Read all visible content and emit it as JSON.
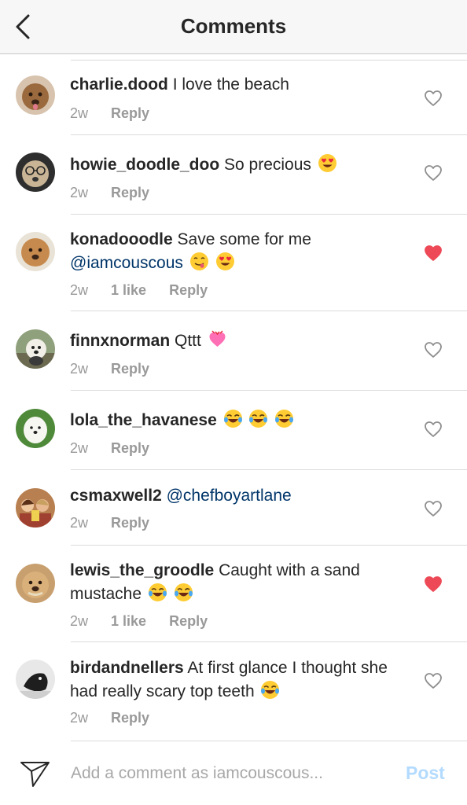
{
  "header": {
    "title": "Comments",
    "back_icon": "chevron-left-icon"
  },
  "comments": [
    {
      "username": "charlie.dood",
      "text": "I love the beach",
      "emojis": [],
      "mention": "",
      "time": "2w",
      "likes": "",
      "reply": "Reply",
      "liked": false
    },
    {
      "username": "howie_doodle_doo",
      "text": "So precious",
      "emojis": [
        "heart-eyes-emoji"
      ],
      "mention": "",
      "time": "2w",
      "likes": "",
      "reply": "Reply",
      "liked": false
    },
    {
      "username": "konadooodle",
      "text": "Save some for me",
      "emojis": [
        "yum-emoji",
        "heart-eyes-emoji"
      ],
      "mention": "@iamcouscous",
      "time": "2w",
      "likes": "1 like",
      "reply": "Reply",
      "liked": true
    },
    {
      "username": "finnxnorman",
      "text": "Qttt",
      "emojis": [
        "heart-ribbon-emoji"
      ],
      "mention": "",
      "time": "2w",
      "likes": "",
      "reply": "Reply",
      "liked": false
    },
    {
      "username": "lola_the_havanese",
      "text": "",
      "emojis": [
        "tears-of-joy-emoji",
        "tears-of-joy-emoji",
        "tears-of-joy-emoji"
      ],
      "mention": "",
      "time": "2w",
      "likes": "",
      "reply": "Reply",
      "liked": false
    },
    {
      "username": "csmaxwell2",
      "text": "",
      "emojis": [],
      "mention": "@chefboyartlane",
      "time": "2w",
      "likes": "",
      "reply": "Reply",
      "liked": false
    },
    {
      "username": "lewis_the_groodle",
      "text": "Caught with a sand mustache",
      "emojis": [
        "tears-of-joy-emoji",
        "tears-of-joy-emoji"
      ],
      "mention": "",
      "time": "2w",
      "likes": "1 like",
      "reply": "Reply",
      "liked": true
    },
    {
      "username": "birdandnellers",
      "text": "At first glance I thought she had really scary top teeth",
      "emojis": [
        "tears-of-joy-emoji"
      ],
      "mention": "",
      "time": "2w",
      "likes": "",
      "reply": "Reply",
      "liked": false
    }
  ],
  "composer": {
    "placeholder": "Add a comment as iamcouscous...",
    "post_label": "Post",
    "send_icon": "paper-plane-icon"
  },
  "colors": {
    "liked_heart": "#ed4956",
    "mention": "#003569",
    "post_disabled": "#b3dbff",
    "meta_text": "#999999"
  }
}
